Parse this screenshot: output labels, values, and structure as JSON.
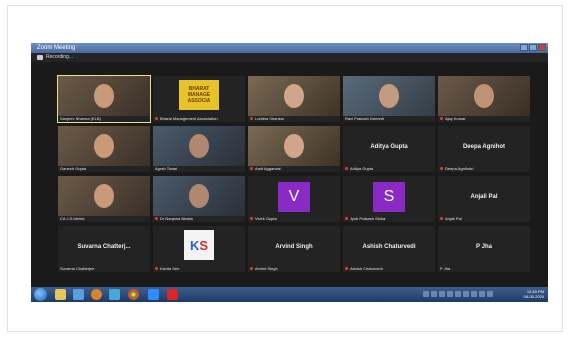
{
  "window": {
    "title": "Zoom Meeting",
    "recording_label": "Recording..."
  },
  "participants": [
    {
      "name": "Sanjeev Sharma (ELB)",
      "muted": false,
      "type": "video",
      "active": true
    },
    {
      "name": "Bharat Management Association",
      "muted": true,
      "type": "logo",
      "logo_text": "BHARAT MANAGE ASSOCIA"
    },
    {
      "name": "Lohitha Shankar",
      "muted": true,
      "type": "video"
    },
    {
      "name": "Ravi Prakash Dwivedi",
      "muted": false,
      "type": "video"
    },
    {
      "name": "Ajay Kumar",
      "muted": true,
      "type": "video"
    },
    {
      "name": "Ganesh Gupta",
      "muted": false,
      "type": "video"
    },
    {
      "name": "Agrah Tiwari",
      "muted": false,
      "type": "video"
    },
    {
      "name": "Amit Aggarwal",
      "muted": true,
      "type": "video"
    },
    {
      "name": "Aditya Gupta",
      "muted": true,
      "type": "name",
      "display_name": "Aditya Gupta"
    },
    {
      "name": "Deepa Agnihotri",
      "muted": true,
      "type": "name",
      "display_name": "Deepa Agnihot"
    },
    {
      "name": "CA J.S.Mehta",
      "muted": false,
      "type": "video"
    },
    {
      "name": "Dr Nanjana Bhatia",
      "muted": true,
      "type": "video"
    },
    {
      "name": "Vivek Gupta",
      "muted": true,
      "type": "avatar",
      "initial": "V",
      "color": "#8a2ac4"
    },
    {
      "name": "Jyoti Prakash Sinha",
      "muted": true,
      "type": "avatar",
      "initial": "S",
      "color": "#8a2ac4"
    },
    {
      "name": "Anjali Pal",
      "muted": true,
      "type": "name",
      "display_name": "Anjali Pal"
    },
    {
      "name": "Suvarna Chatterjee",
      "muted": false,
      "type": "name",
      "display_name": "Suvarna Chatterj..."
    },
    {
      "name": "Kavita Sen",
      "muted": true,
      "type": "logo_ks"
    },
    {
      "name": "Arvind Singh",
      "muted": true,
      "type": "name",
      "display_name": "Arvind Singh"
    },
    {
      "name": "Ashish Chaturvedi",
      "muted": true,
      "type": "name",
      "display_name": "Ashish Chaturvedi"
    },
    {
      "name": "P Jha",
      "muted": false,
      "type": "name",
      "display_name": "P Jha"
    }
  ],
  "tray": {
    "time": "12:45 PM",
    "date": "08-05-2020"
  },
  "colors": {
    "muted": "#d23a2c",
    "avatar_purple": "#8a2ac4",
    "active_border": "#e6e08a"
  }
}
